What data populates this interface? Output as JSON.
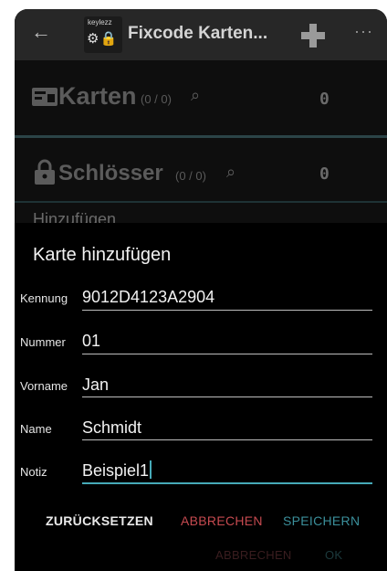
{
  "appbar": {
    "back_icon": "arrow-left-icon",
    "logo_text": "keylezz",
    "logo_glyph": "⚙🔒",
    "title": "Fixcode Karten...",
    "add_icon": "plus-icon",
    "more": "···"
  },
  "cards": {
    "icon": "card-icon",
    "title": "Karten",
    "count": "(0 / 0)",
    "value": "0"
  },
  "locks": {
    "icon": "lock-icon",
    "title": "Schlösser",
    "count": "(0 / 0)",
    "value": "0"
  },
  "behind_dialog_text": "Hinzufügen",
  "dialog": {
    "title": "Karte hinzufügen",
    "fields": [
      {
        "label": "Kennung",
        "value": "9012D4123A2904"
      },
      {
        "label": "Nummer",
        "value": "01"
      },
      {
        "label": "Vorname",
        "value": "Jan"
      },
      {
        "label": "Name",
        "value": "Schmidt"
      },
      {
        "label": "Notiz",
        "value": "Beispiel1"
      }
    ],
    "buttons": {
      "reset": "ZURÜCKSETZEN",
      "cancel": "ABBRECHEN",
      "save": "SPEICHERN"
    },
    "background_buttons": {
      "cancel": "ABBRECHEN",
      "ok": "OK"
    }
  },
  "colors": {
    "accent": "#46aab8",
    "cancel": "#c64a50",
    "save": "#3b8f9b"
  }
}
